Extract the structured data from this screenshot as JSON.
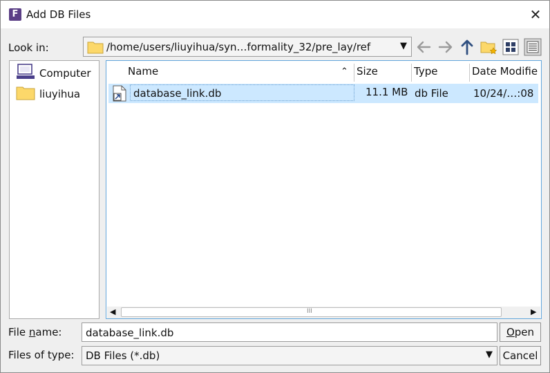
{
  "window": {
    "title": "Add DB Files",
    "app_icon_letter": "F",
    "accent": "#5b3f86"
  },
  "toolbar": {
    "look_in_label": "Look in:",
    "path": "/home/users/liuyihua/syn…formality_32/pre_lay/ref",
    "icons": [
      "arrow-left-icon",
      "arrow-right-icon",
      "arrow-up-icon",
      "new-folder-icon",
      "list-mode-icon",
      "detail-mode-icon"
    ]
  },
  "sidebar": {
    "items": [
      {
        "label": "Computer",
        "icon": "computer-icon"
      },
      {
        "label": "liuyihua",
        "icon": "folder-icon"
      }
    ]
  },
  "filelist": {
    "columns": [
      "Name",
      "Size",
      "Type",
      "Date Modifie"
    ],
    "sort": "name-ascending",
    "rows": [
      {
        "name": "database_link.db",
        "size": "11.1 MB",
        "type": "db File",
        "date": "10/24/…:08",
        "selected": true
      }
    ],
    "scroll_mid_glyph": "III"
  },
  "footer": {
    "file_name_label_pre": "File ",
    "file_name_label_ul": "n",
    "file_name_label_post": "ame:",
    "file_name_value": "database_link.db",
    "files_of_type_label": "Files of type:",
    "files_of_type_value": "DB Files (*.db)",
    "open_pre": "",
    "open_ul": "O",
    "open_post": "pen",
    "cancel_label": "Cancel"
  }
}
